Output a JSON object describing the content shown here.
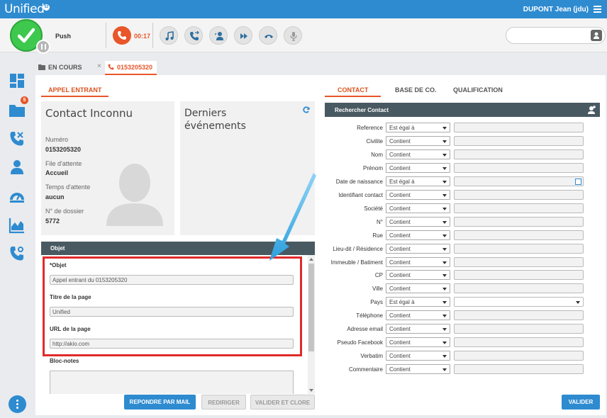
{
  "app": {
    "logo": "Unified",
    "logo_badge": "52",
    "user": "DUPONT Jean (jdu)"
  },
  "callbar": {
    "push_label": "Push",
    "timer": "00:17"
  },
  "sidebar": {
    "badge_count": "5"
  },
  "tabs": {
    "encours": "EN COURS",
    "close": "×",
    "number": "0153205320"
  },
  "left": {
    "tab": "APPEL ENTRANT",
    "contact": {
      "title": "Contact Inconnu",
      "fields": [
        {
          "label": "Numéro",
          "value": "0153205320"
        },
        {
          "label": "File d'attente",
          "value": "Accueil"
        },
        {
          "label": "Temps d'attente",
          "value": "aucun"
        },
        {
          "label": "N° de dossier",
          "value": "5772"
        }
      ]
    },
    "events_title": "Derniers événements",
    "objet": {
      "header": "Objet",
      "objet_label": "*Objet",
      "objet_value": "Appel entrant du 0153205320",
      "titre_label": "Titre de la page",
      "titre_value": "Unified",
      "url_label": "URL de la page",
      "url_value": "http://akio.com",
      "notes_label": "Bloc-notes"
    },
    "buttons": {
      "mail": "REPONDRE PAR MAIL",
      "redirect": "REDIRIGER",
      "validate_close": "VALIDER ET CLORE"
    }
  },
  "right": {
    "tabs": [
      "CONTACT",
      "BASE DE CO.",
      "QUALIFICATION"
    ],
    "header": "Rechercher Contact",
    "rows": [
      {
        "label": "Reference",
        "op": "Est égal à"
      },
      {
        "label": "Civilite",
        "op": "Contient"
      },
      {
        "label": "Nom",
        "op": "Contient"
      },
      {
        "label": "Prénom",
        "op": "Contient"
      },
      {
        "label": "Date de naissance",
        "op": "Est égal à"
      },
      {
        "label": "Identifiant contact",
        "op": "Contient"
      },
      {
        "label": "Société",
        "op": "Contient"
      },
      {
        "label": "N°",
        "op": "Contient"
      },
      {
        "label": "Rue",
        "op": "Contient"
      },
      {
        "label": "Lieu-dit / Résidence",
        "op": "Contient"
      },
      {
        "label": "Immeuble / Batiment",
        "op": "Contient"
      },
      {
        "label": "CP",
        "op": "Contient"
      },
      {
        "label": "Ville",
        "op": "Contient"
      },
      {
        "label": "Pays",
        "op": "Est égal à"
      },
      {
        "label": "Téléphone",
        "op": "Contient"
      },
      {
        "label": "Adresse email",
        "op": "Contient"
      },
      {
        "label": "Pseudo Facebook",
        "op": "Contient"
      },
      {
        "label": "Verbatim",
        "op": "Contient"
      },
      {
        "label": "Commentaire",
        "op": "Contient"
      }
    ],
    "validate": "VALIDER"
  },
  "colors": {
    "brand": "#2e8bd0",
    "accent": "#e8562a",
    "status_green": "#3ec84d",
    "highlight": "#e02a2a",
    "header_dark": "#495962"
  }
}
